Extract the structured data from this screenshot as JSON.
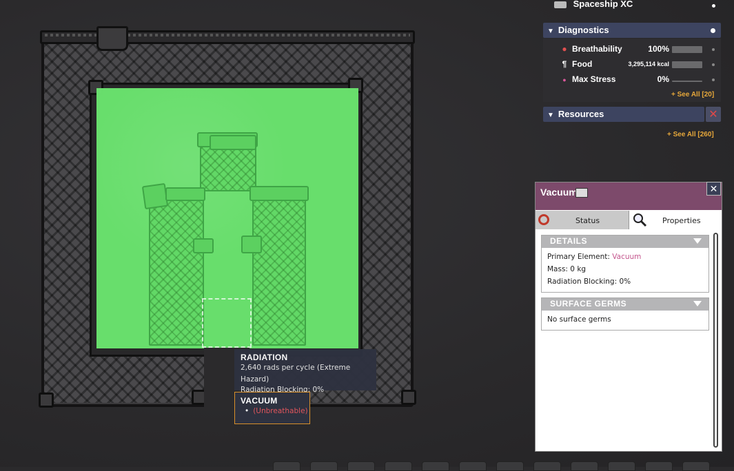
{
  "hud": {
    "ship_name": "Spaceship XC",
    "diagnostics": {
      "title": "Diagnostics",
      "items": [
        {
          "label": "Breathability",
          "value": "100%",
          "icon": "lungs-icon"
        },
        {
          "label": "Food",
          "value": "3,295,114 kcal",
          "icon": "fork-knife-icon"
        },
        {
          "label": "Max Stress",
          "value": "0%",
          "icon": "stress-icon"
        }
      ],
      "see_all": "+ See All [20]"
    },
    "resources": {
      "title": "Resources",
      "see_all": "+ See All [260]"
    },
    "colors": {
      "accent": "#e6a73a",
      "header": "#3d4460",
      "danger": "#e04848"
    }
  },
  "tooltip": {
    "radiation_title": "RADIATION",
    "radiation_line1": "2,640 rads per cycle (Extreme Hazard)",
    "radiation_line2": "Radiation Blocking: 0%",
    "vacuum_title": "VACUUM",
    "vacuum_bullet": "(Unbreathable)"
  },
  "detail_panel": {
    "title": "Vacuum",
    "tabs": [
      {
        "label": "Status"
      },
      {
        "label": "Properties"
      }
    ],
    "details": {
      "header": "DETAILS",
      "primary_label": "Primary Element: ",
      "primary_value": "Vacuum",
      "mass": "Mass: 0 kg",
      "radiation_blocking": "Radiation Blocking: 0%"
    },
    "germs": {
      "header": "SURFACE GERMS",
      "text": "No surface germs"
    },
    "colors": {
      "header_bg": "#7d4a6b",
      "element_link": "#c4558d"
    }
  }
}
